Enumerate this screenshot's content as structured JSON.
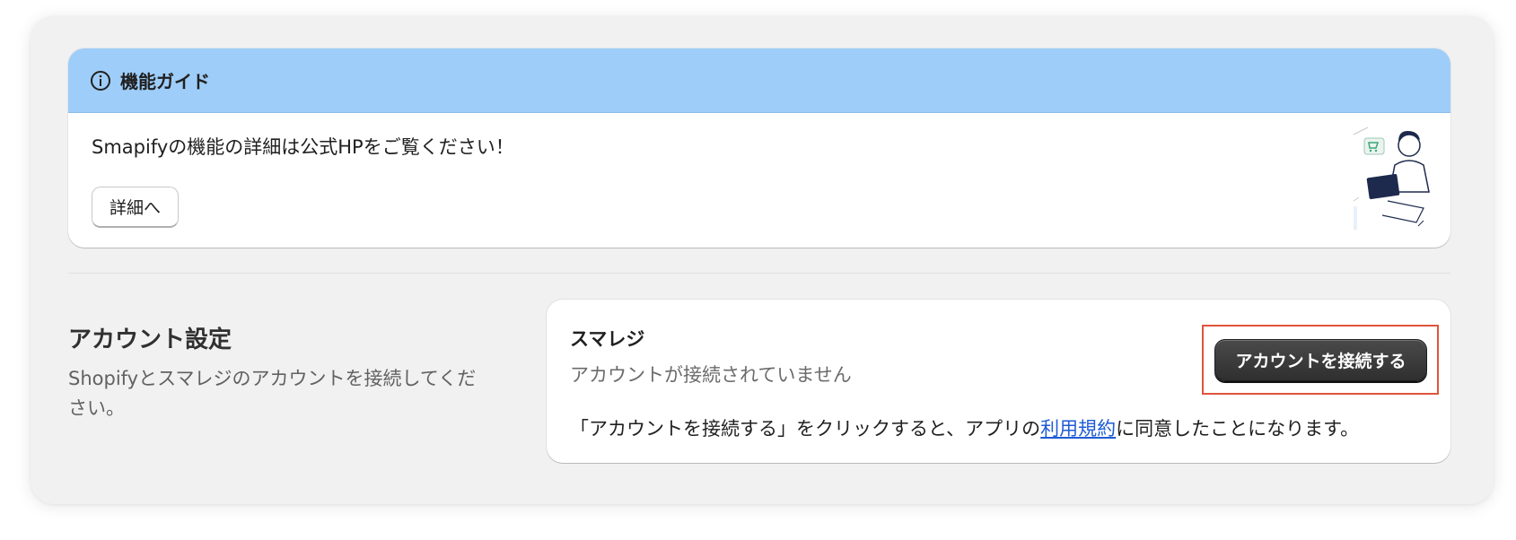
{
  "guide": {
    "title": "機能ガイド",
    "body": "Smapifyの機能の詳細は公式HPをご覧ください！",
    "details_button": "詳細へ",
    "icon": "info-icon",
    "header_color": "#9ecdf9"
  },
  "account": {
    "title": "アカウント設定",
    "description": "Shopifyとスマレジのアカウントを接続してください。"
  },
  "card": {
    "title": "スマレジ",
    "status": "アカウントが接続されていません",
    "connect_button": "アカウントを接続する",
    "terms_prefix": "「アカウントを接続する」をクリックすると、アプリの",
    "terms_link": "利用規約",
    "terms_suffix": "に同意したことになります。",
    "highlight_color": "#e1543b"
  }
}
